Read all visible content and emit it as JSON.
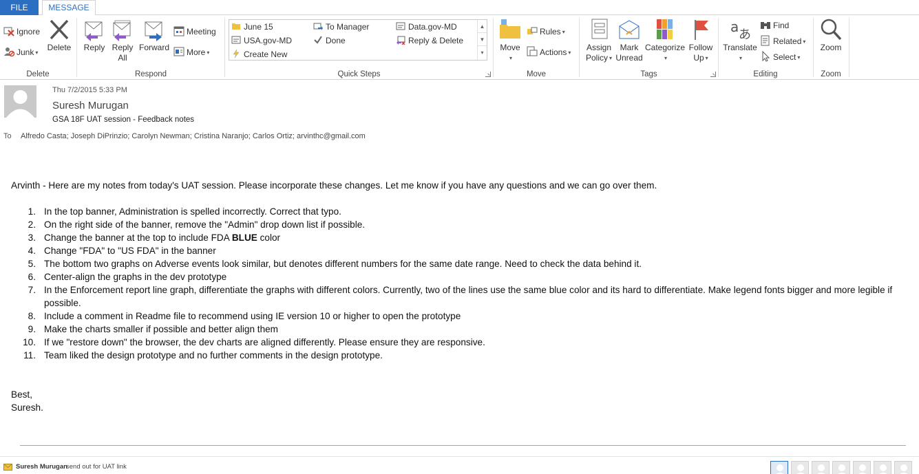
{
  "tabs": {
    "file": "FILE",
    "message": "MESSAGE"
  },
  "ribbon": {
    "delete_group": {
      "label": "Delete",
      "ignore": "Ignore",
      "junk": "Junk",
      "delete": "Delete"
    },
    "respond_group": {
      "label": "Respond",
      "reply": "Reply",
      "reply_all_1": "Reply",
      "reply_all_2": "All",
      "forward": "Forward",
      "meeting": "Meeting",
      "more": "More"
    },
    "quick_steps": {
      "label": "Quick Steps",
      "items": [
        "June 15",
        "USA.gov-MD",
        "Create New",
        "To Manager",
        "Done",
        "Data.gov-MD",
        "Reply & Delete"
      ]
    },
    "move_group": {
      "label": "Move",
      "move": "Move",
      "rules": "Rules",
      "actions": "Actions"
    },
    "tags_group": {
      "label": "Tags",
      "assign_1": "Assign",
      "assign_2": "Policy",
      "mark_1": "Mark",
      "mark_2": "Unread",
      "categorize": "Categorize",
      "follow_1": "Follow",
      "follow_2": "Up"
    },
    "editing_group": {
      "label": "Editing",
      "translate": "Translate",
      "find": "Find",
      "related": "Related",
      "select": "Select"
    },
    "zoom_group": {
      "label": "Zoom",
      "zoom": "Zoom"
    }
  },
  "message": {
    "date": "Thu 7/2/2015 5:33 PM",
    "sender": "Suresh Murugan",
    "subject": "GSA 18F UAT session - Feedback notes",
    "to_label": "To",
    "recipients": "Alfredo Casta; Joseph DiPrinzio; Carolyn Newman; Cristina Naranjo; Carlos Ortiz; arvinthc@gmail.com",
    "intro": "Arvinth - Here are my notes from today's UAT session. Please incorporate these changes. Let me know if you have any questions and we can go over them.",
    "notes": [
      {
        "n": "1.",
        "text": "In the top banner, Administration is spelled incorrectly. Correct that typo."
      },
      {
        "n": "2.",
        "text": "On the right side of the banner, remove the \"Admin\" drop down list if possible."
      },
      {
        "n": "3.",
        "text": "Change the banner at the top to include FDA ",
        "bold": "BLUE",
        "after": " color"
      },
      {
        "n": "4.",
        "text": "Change \"FDA\" to \"US FDA\" in the banner"
      },
      {
        "n": "5.",
        "text": "The bottom two graphs on Adverse events look similar, but denotes different numbers for the same date range. Need to check the data behind it."
      },
      {
        "n": "6.",
        "text": "Center-align the graphs in the dev prototype"
      },
      {
        "n": "7.",
        "text": "In the Enforcement report line graph, differentiate the graphs with different colors. Currently, two of the lines use the same blue color and its hard to differentiate. Make legend fonts bigger and more legible if possible."
      },
      {
        "n": "8.",
        "text": "Include a comment in Readme file to recommend using IE version 10 or higher to open the prototype"
      },
      {
        "n": "9.",
        "text": "Make the charts smaller if possible and better align them"
      },
      {
        "n": "10.",
        "text": "If we \"restore down\" the browser, the dev charts are aligned differently. Please ensure they are responsive."
      },
      {
        "n": "11.",
        "text": "Team liked the design prototype and no further comments in the design prototype."
      }
    ],
    "signoff_1": "Best,",
    "signoff_2": "Suresh."
  },
  "statusbar": {
    "name": "Suresh Murugan",
    "text": "send out for UAT link"
  },
  "colors": {
    "accent": "#2b6fc2",
    "reply_arrow": "#8e5bc9",
    "forward_arrow": "#2b6fc2",
    "follow_flag": "#e05040"
  }
}
